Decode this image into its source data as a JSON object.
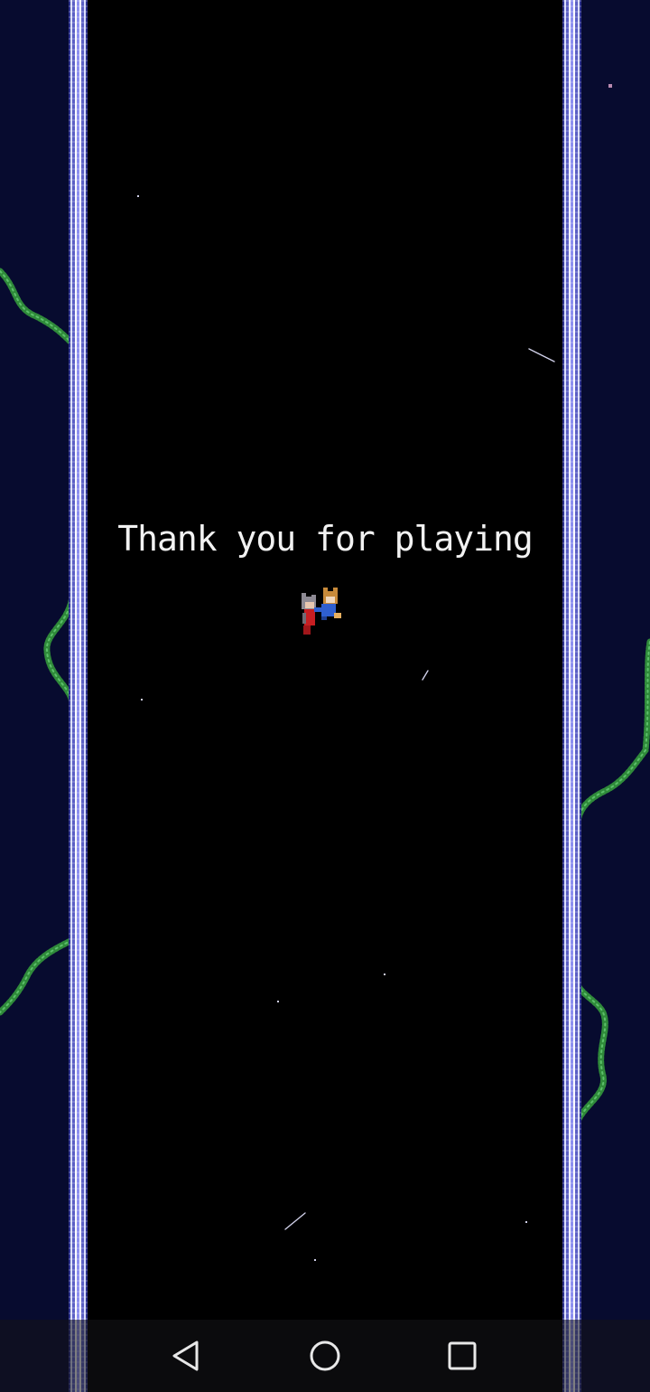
{
  "ending": {
    "title": "Thank you for playing"
  },
  "scene": {
    "background_color": "#000000",
    "side_panel_color": "#070b2f",
    "vine_color": "#2f8a3a",
    "star_color": "#cfcfe8"
  },
  "characters": {
    "icon": "two-characters-hugging-sprite"
  },
  "navigation_bar": {
    "back_icon": "back-triangle-icon",
    "home_icon": "home-circle-icon",
    "recents_icon": "recents-square-icon"
  }
}
